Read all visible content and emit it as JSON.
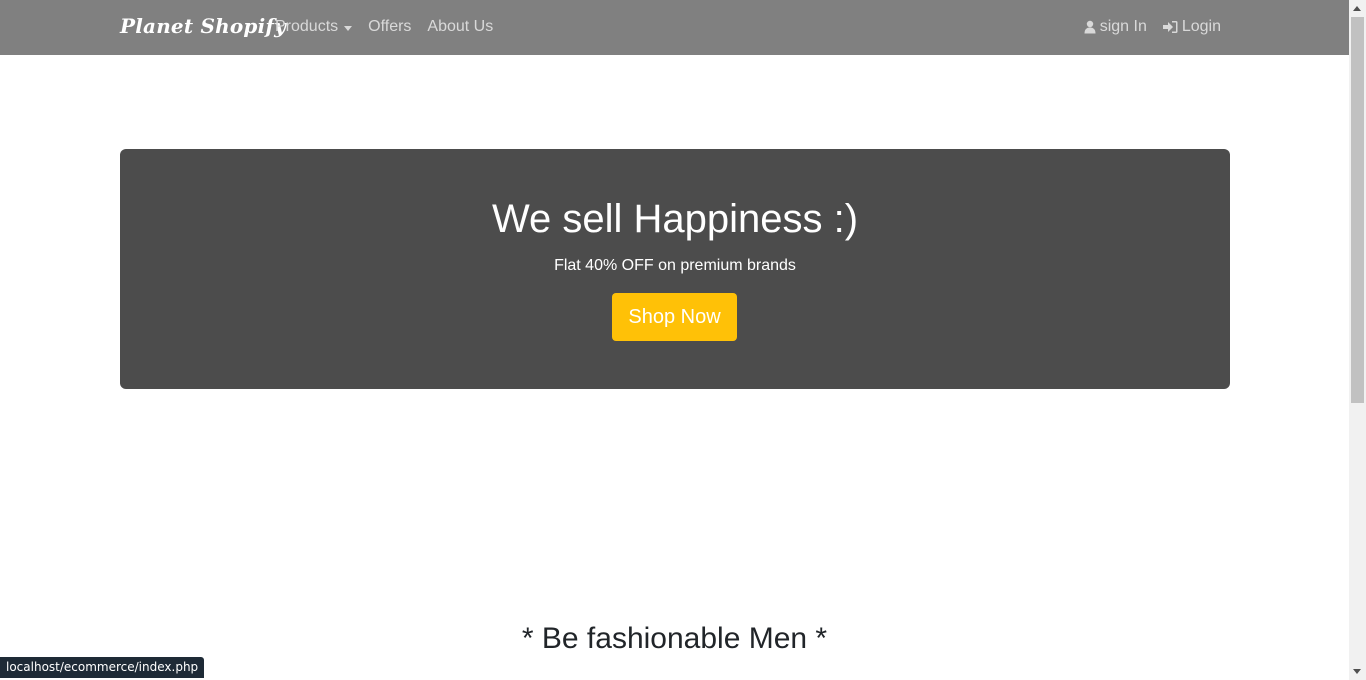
{
  "navbar": {
    "brand": "Planet Shopify",
    "links": [
      {
        "label": "Products",
        "has_dropdown": true
      },
      {
        "label": "Offers"
      },
      {
        "label": "About Us"
      }
    ],
    "right_links": [
      {
        "label": "sign In",
        "icon": "user-icon"
      },
      {
        "label": "Login",
        "icon": "sign-in-icon"
      }
    ]
  },
  "hero": {
    "title": "We sell Happiness :)",
    "subtitle": "Flat 40% OFF on premium brands",
    "cta_label": "Shop Now"
  },
  "section": {
    "heading": "* Be fashionable Men *"
  },
  "status_bar": {
    "url": "localhost/ecommerce/index.php"
  },
  "colors": {
    "navbar": "#808080",
    "hero_bg": "#4c4c4c",
    "cta": "#ffc107"
  }
}
